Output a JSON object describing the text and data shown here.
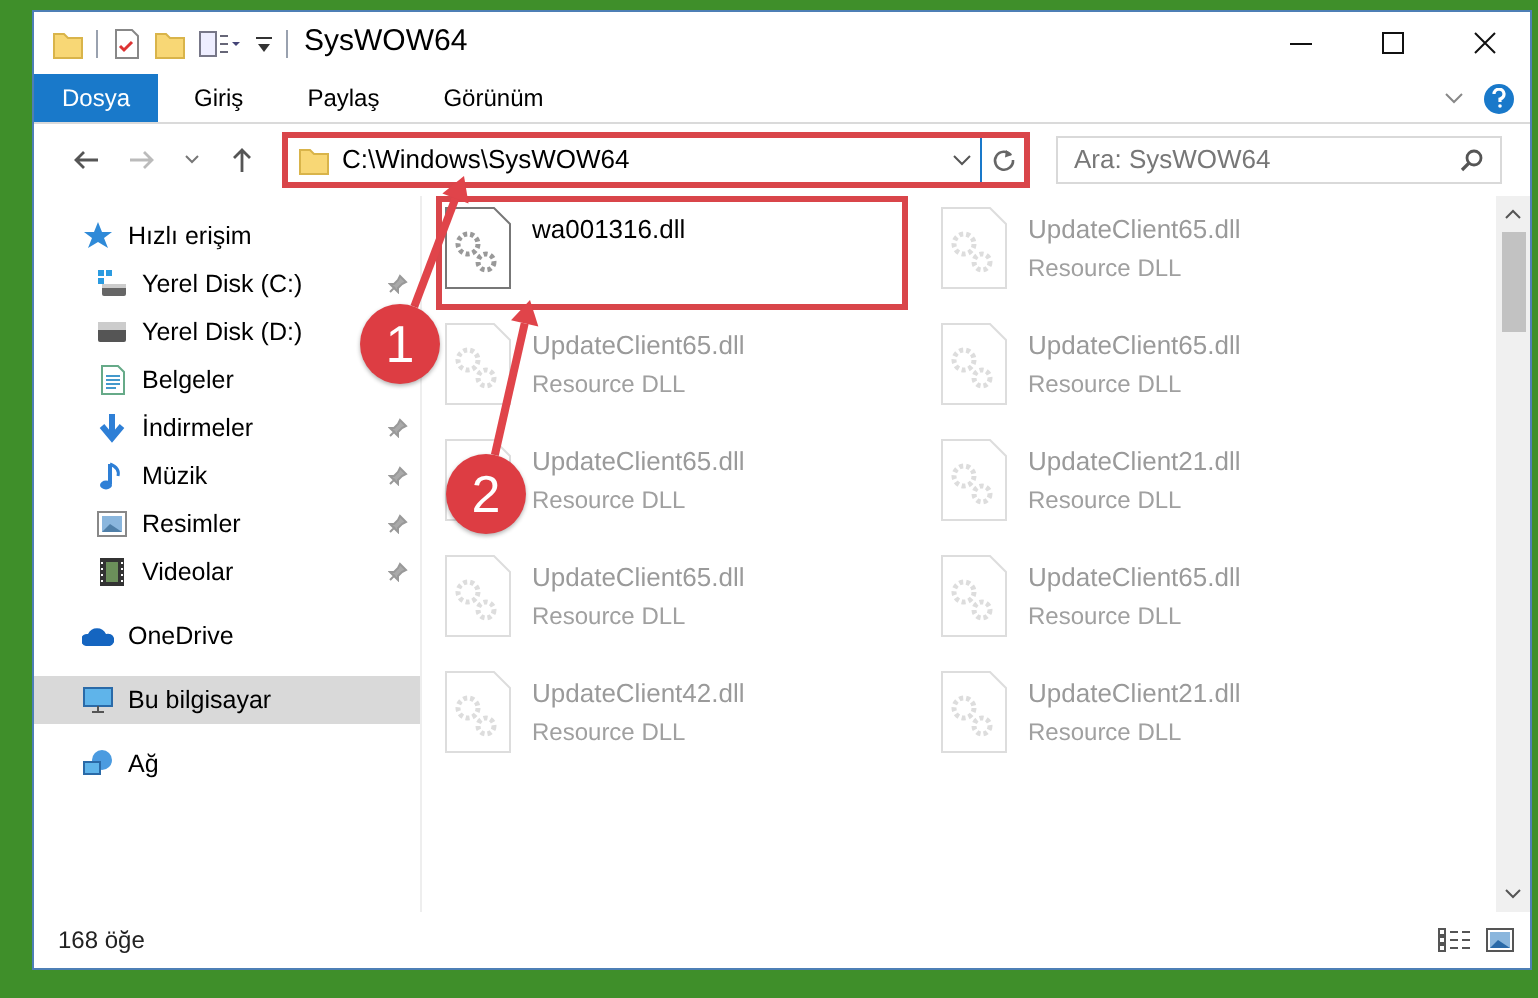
{
  "window": {
    "title": "SysWOW64"
  },
  "ribbon_tabs": [
    {
      "label": "Dosya",
      "selected": true
    },
    {
      "label": "Giriş",
      "selected": false
    },
    {
      "label": "Paylaş",
      "selected": false
    },
    {
      "label": "Görünüm",
      "selected": false
    }
  ],
  "address": {
    "path": "C:\\Windows\\SysWOW64",
    "highlighted": true
  },
  "search": {
    "placeholder": "Ara: SysWOW64"
  },
  "sidebar": {
    "items": [
      {
        "label": "Hızlı erişim",
        "kind": "star",
        "selected": false,
        "children": [
          {
            "label": "Yerel Disk (C:)",
            "kind": "drive-c",
            "pinned": true
          },
          {
            "label": "Yerel Disk (D:)",
            "kind": "drive"
          },
          {
            "label": "Belgeler",
            "kind": "document",
            "pinned": false
          },
          {
            "label": "İndirmeler",
            "kind": "download",
            "pinned": true
          },
          {
            "label": "Müzik",
            "kind": "music",
            "pinned": true
          },
          {
            "label": "Resimler",
            "kind": "picture",
            "pinned": true
          },
          {
            "label": "Videolar",
            "kind": "video",
            "pinned": true
          }
        ]
      },
      {
        "label": "OneDrive",
        "kind": "cloud",
        "selected": false
      },
      {
        "label": "Bu bilgisayar",
        "kind": "computer",
        "selected": true
      },
      {
        "label": "Ağ",
        "kind": "network",
        "selected": false
      }
    ]
  },
  "files": [
    {
      "name": "wa001316.dll",
      "highlighted": true
    },
    {
      "name": "UpdateClient65.dll",
      "type": "Resource DLL",
      "highlighted": false
    },
    {
      "name": "UpdateClient65.dll",
      "type": "Resource DLL",
      "highlighted": false
    },
    {
      "name": "UpdateClient65.dll",
      "type": "Resource DLL",
      "highlighted": false
    },
    {
      "name": "UpdateClient65.dll",
      "type": "Resource DLL",
      "highlighted": false
    },
    {
      "name": "UpdateClient21.dll",
      "type": "Resource DLL",
      "highlighted": false
    },
    {
      "name": "UpdateClient65.dll",
      "type": "Resource DLL",
      "highlighted": false
    },
    {
      "name": "UpdateClient65.dll",
      "type": "Resource DLL",
      "highlighted": false
    },
    {
      "name": "UpdateClient42.dll",
      "type": "Resource DLL",
      "highlighted": false
    },
    {
      "name": "UpdateClient21.dll",
      "type": "Resource DLL",
      "highlighted": false
    }
  ],
  "annotations": [
    {
      "number": "1"
    },
    {
      "number": "2"
    }
  ],
  "status_bar": {
    "item_count": "168 öğe"
  }
}
